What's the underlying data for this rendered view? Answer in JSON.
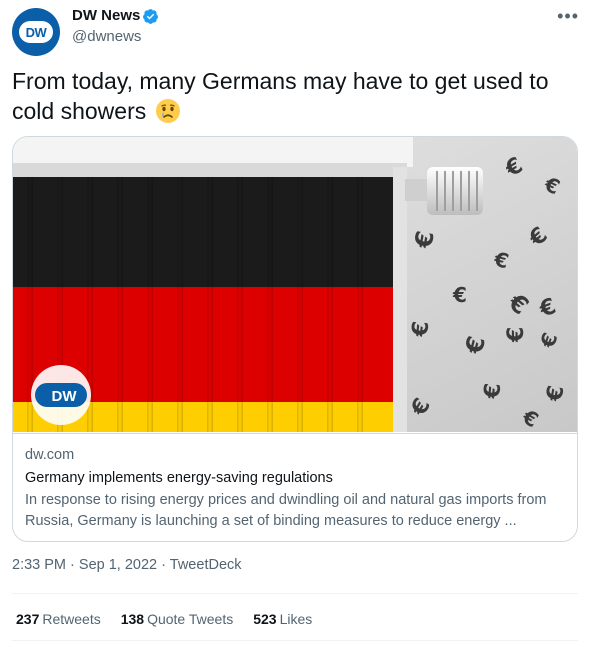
{
  "author": {
    "name": "DW News",
    "handle": "@dwnews",
    "avatar_text": "DW",
    "verified": true
  },
  "menu": {
    "more_label": "•••"
  },
  "tweet": {
    "text": "From today, many Germans may have to get used to cold showers",
    "emoji": "crying-face"
  },
  "card": {
    "image_logo": "DW",
    "domain": "dw.com",
    "title": "Germany implements energy-saving regulations",
    "description": "In response to rising energy prices and dwindling oil and natural gas imports from Russia, Germany is launching a set of binding measures to reduce energy ..."
  },
  "meta": {
    "time": "2:33 PM",
    "date": "Sep 1, 2022",
    "source": "TweetDeck",
    "separator": "·"
  },
  "stats": {
    "retweets_count": "237",
    "retweets_label": "Retweets",
    "quotes_count": "138",
    "quotes_label": "Quote Tweets",
    "likes_count": "523",
    "likes_label": "Likes"
  },
  "colors": {
    "brand_blue": "#0a5fa8",
    "verified_blue": "#1d9bf0",
    "flag_black": "#1b1b1b",
    "flag_red": "#dd0000",
    "flag_gold": "#ffce00",
    "muted_text": "#536471"
  }
}
